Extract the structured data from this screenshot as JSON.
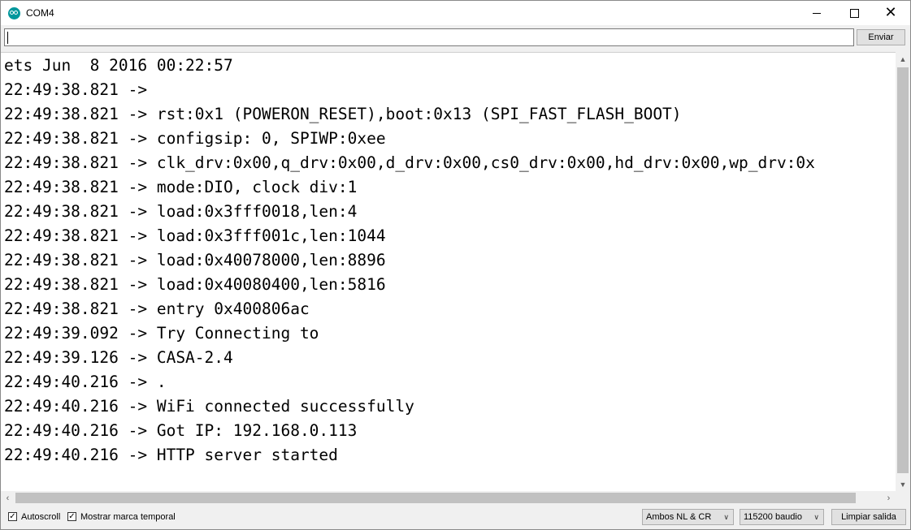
{
  "window": {
    "title": "COM4"
  },
  "input_bar": {
    "value": "",
    "send_label": "Enviar"
  },
  "console": {
    "lines": [
      "ets Jun  8 2016 00:22:57",
      "22:49:38.821 ->",
      "22:49:38.821 -> rst:0x1 (POWERON_RESET),boot:0x13 (SPI_FAST_FLASH_BOOT)",
      "22:49:38.821 -> configsip: 0, SPIWP:0xee",
      "22:49:38.821 -> clk_drv:0x00,q_drv:0x00,d_drv:0x00,cs0_drv:0x00,hd_drv:0x00,wp_drv:0x",
      "22:49:38.821 -> mode:DIO, clock div:1",
      "22:49:38.821 -> load:0x3fff0018,len:4",
      "22:49:38.821 -> load:0x3fff001c,len:1044",
      "22:49:38.821 -> load:0x40078000,len:8896",
      "22:49:38.821 -> load:0x40080400,len:5816",
      "22:49:38.821 -> entry 0x400806ac",
      "22:49:39.092 -> Try Connecting to",
      "22:49:39.126 -> CASA-2.4",
      "22:49:40.216 -> .",
      "22:49:40.216 -> WiFi connected successfully",
      "22:49:40.216 -> Got IP: 192.168.0.113",
      "22:49:40.216 -> HTTP server started"
    ]
  },
  "statusbar": {
    "autoscroll_label": "Autoscroll",
    "autoscroll_checked": true,
    "timestamp_label": "Mostrar marca temporal",
    "timestamp_checked": true,
    "line_ending": "Ambos NL & CR",
    "baud_rate": "115200 baudio",
    "clear_label": "Limpiar salida"
  },
  "icons": {
    "app": "arduino-icon",
    "minimize": "minimize-icon",
    "maximize": "maximize-icon",
    "close": "close-icon",
    "check": "checkmark-icon",
    "dropdown": "chevron-down-icon"
  },
  "colors": {
    "accent": "#00979c",
    "scroll_thumb": "#c1c1c1",
    "chrome": "#f0f0f0"
  }
}
